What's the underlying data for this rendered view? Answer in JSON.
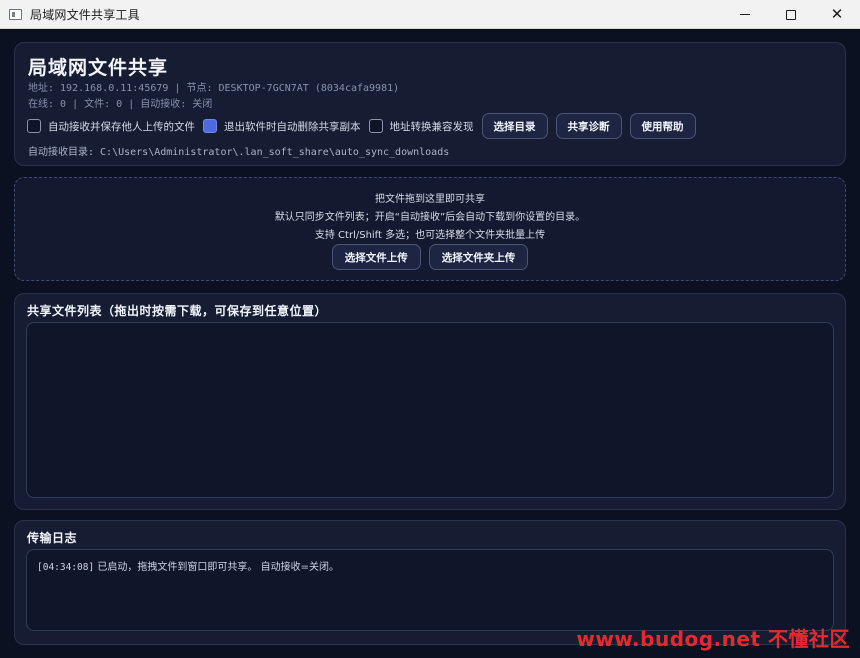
{
  "window": {
    "title": "局域网文件共享工具",
    "minimize_icon": "minimize-icon",
    "maximize_icon": "maximize-icon",
    "close_icon": "close-icon",
    "close_glyph": "✕"
  },
  "header": {
    "title": "局域网文件共享",
    "address_line": "地址: 192.168.0.11:45679 | 节点: DESKTOP-7GCN7AT (8034cafa9981)",
    "status_line": "在线: 0 | 文件: 0 | 自动接收: 关闭",
    "options": [
      {
        "label": "自动接收并保存他人上传的文件",
        "checked": false
      },
      {
        "label": "退出软件时自动删除共享副本",
        "checked": true
      },
      {
        "label": "地址转换兼容发现",
        "checked": false
      }
    ],
    "buttons": {
      "select_dir": "选择目录",
      "share_diagnose": "共享诊断",
      "help": "使用帮助"
    },
    "auto_receive_dir": "自动接收目录: C:\\Users\\Administrator\\.lan_soft_share\\auto_sync_downloads"
  },
  "drop_zone": {
    "line1": "把文件拖到这里即可共享",
    "line2": "默认只同步文件列表；开启“自动接收”后会自动下载到你设置的目录。",
    "line3": "支持 Ctrl/Shift 多选；也可选择整个文件夹批量上传",
    "upload_file_label": "选择文件上传",
    "upload_folder_label": "选择文件夹上传"
  },
  "shared_list": {
    "title": "共享文件列表（拖出时按需下载，可保存到任意位置）",
    "items": []
  },
  "log": {
    "title": "传输日志",
    "entries": [
      {
        "time": "[04:34:08]",
        "message": "已启动，拖拽文件到窗口即可共享。 自动接收=关闭。"
      }
    ]
  },
  "watermark": "www.budog.net 不懂社区",
  "colors": {
    "background": "#0c1121",
    "panel": "#161d33",
    "accent_checkbox": "#4f6ae0",
    "watermark": "#e9282d"
  }
}
